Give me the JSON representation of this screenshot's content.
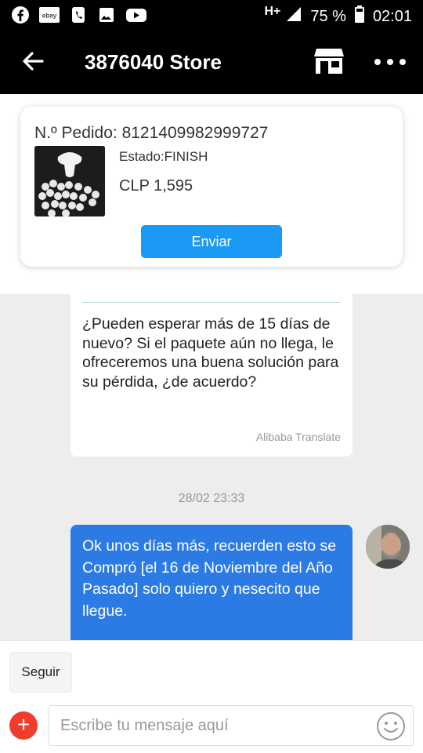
{
  "status_bar": {
    "apps": [
      "facebook-icon",
      "ebay-icon",
      "phone-icon",
      "gallery-icon",
      "youtube-icon"
    ],
    "ebay_text": "ebay",
    "network": "H+",
    "battery": "75 %",
    "time": "02:01"
  },
  "header": {
    "title": "3876040 Store"
  },
  "order": {
    "number": "N.º Pedido: 8121409982999727",
    "status": "Estado:FINISH",
    "price": "CLP 1,595",
    "send_label": "Enviar"
  },
  "chat": {
    "incoming_text": "¿Pueden esperar más de 15 días de nuevo? Si el paquete aún no llega, le ofreceremos una buena solución para su pérdida, ¿de acuerdo?",
    "translate_label": "Alibaba Translate",
    "timestamp": "28/02 23:33",
    "outgoing_text": "Ok unos días más, recuerden esto se Compró [el 16 de Noviembre del Año Pasado] solo quiero y nesecito que llegue."
  },
  "composer": {
    "follow_label": "Seguir",
    "placeholder": "Escribe tu mensaje aquí"
  },
  "colors": {
    "send_button": "#1a9af5",
    "outgoing_bubble": "#2c7be5",
    "plus_button": "#f03c2c"
  }
}
